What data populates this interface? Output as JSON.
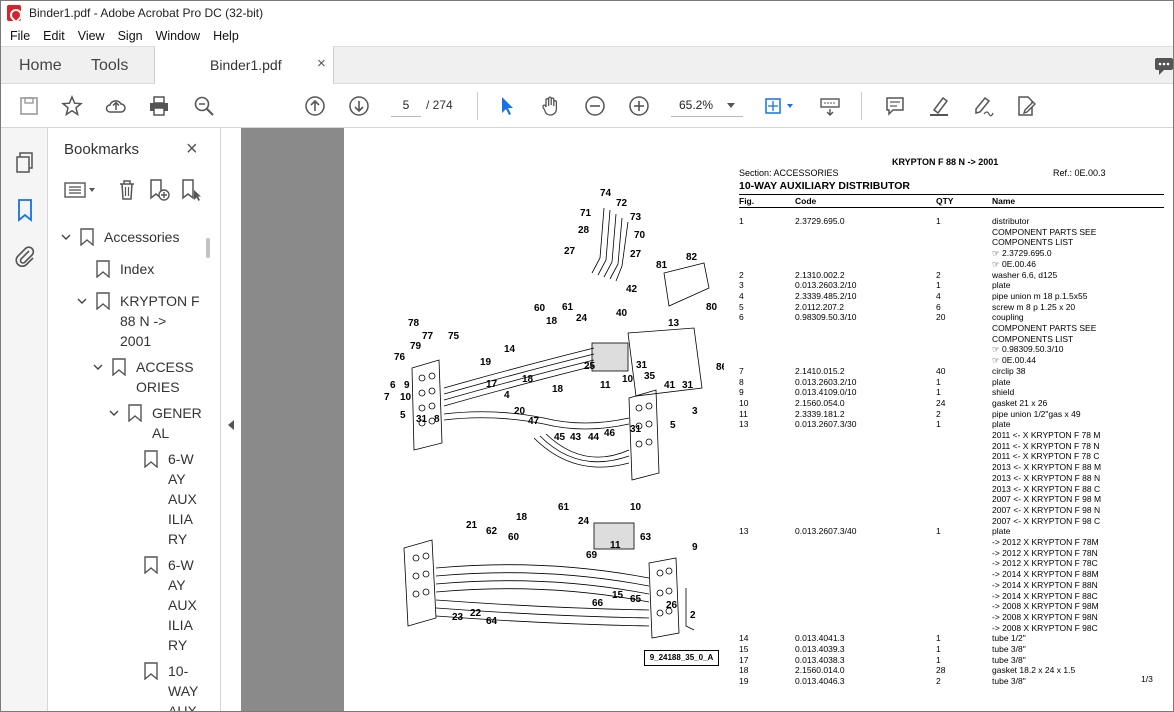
{
  "window": {
    "title": "Binder1.pdf - Adobe Acrobat Pro DC (32-bit)"
  },
  "menu": [
    "File",
    "Edit",
    "View",
    "Sign",
    "Window",
    "Help"
  ],
  "tabs": {
    "home": "Home",
    "tools": "Tools",
    "doc": "Binder1.pdf",
    "close": "×"
  },
  "toolbar": {
    "page_current": "5",
    "page_total": "/  274",
    "zoom": "65.2%"
  },
  "bookmarks": {
    "title": "Bookmarks",
    "close": "×",
    "items": [
      {
        "label": "Accessories"
      },
      {
        "label": "Index"
      },
      {
        "label_lines": [
          "KRYPTON F",
          "88 N ->",
          "2001"
        ]
      },
      {
        "label_lines": [
          "ACCESS",
          "ORIES"
        ]
      },
      {
        "label_lines": [
          "GENER",
          "AL"
        ]
      },
      {
        "label_lines": [
          "6-W",
          "AY",
          "AUX",
          "ILIA",
          "RY"
        ]
      },
      {
        "label_lines": [
          "6-W",
          "AY",
          "AUX",
          "ILIA",
          "RY"
        ]
      },
      {
        "label_lines": [
          "10-",
          "WAY",
          "AUX"
        ]
      }
    ]
  },
  "document": {
    "title": "KRYPTON F 88 N -> 2001",
    "section": "Section: ACCESSORIES",
    "ref": "Ref.: 0E.00.3",
    "heading": "10-WAY AUXILIARY DISTRIBUTOR",
    "columns": [
      "Fig.",
      "Code",
      "QTY",
      "Name"
    ],
    "figure_code": "9_24188_35_0_A",
    "page_number": "1/3",
    "drawing_labels": [
      "74",
      "72",
      "71",
      "73",
      "28",
      "70",
      "27",
      "27",
      "82",
      "81",
      "42",
      "80",
      "60",
      "61",
      "18",
      "24",
      "40",
      "13",
      "78",
      "77",
      "75",
      "79",
      "76",
      "19",
      "14",
      "25",
      "31",
      "86",
      "35",
      "10",
      "18",
      "17",
      "6",
      "9",
      "7",
      "10",
      "5",
      "31",
      "8",
      "4",
      "18",
      "11",
      "41",
      "31",
      "3",
      "20",
      "47",
      "46",
      "45",
      "43",
      "44",
      "31",
      "5",
      "10",
      "61",
      "18",
      "24",
      "21",
      "62",
      "60",
      "11",
      "63",
      "9",
      "69",
      "15",
      "66",
      "65",
      "26",
      "2",
      "23",
      "22",
      "64"
    ],
    "rows": [
      {
        "fig": "1",
        "code": "2.3729.695.0",
        "qty": "1",
        "name": [
          "distributor",
          "COMPONENT PARTS SEE",
          "COMPONENTS LIST",
          "☞ 2.3729.695.0",
          "☞ 0E.00.46"
        ]
      },
      {
        "fig": "2",
        "code": "2.1310.002.2",
        "qty": "2",
        "name": [
          "washer 6.6, d125"
        ]
      },
      {
        "fig": "3",
        "code": "0.013.2603.2/10",
        "qty": "1",
        "name": [
          "plate"
        ]
      },
      {
        "fig": "4",
        "code": "2.3339.485.2/10",
        "qty": "4",
        "name": [
          "pipe union m 18 p.1.5x55"
        ]
      },
      {
        "fig": "5",
        "code": "2.0112.207.2",
        "qty": "6",
        "name": [
          "screw m 8 p 1.25 x 20"
        ]
      },
      {
        "fig": "6",
        "code": "0.98309.50.3/10",
        "qty": "20",
        "name": [
          "coupling",
          "COMPONENT PARTS SEE",
          "COMPONENTS LIST",
          "☞ 0.98309.50.3/10",
          "☞ 0E.00.44"
        ]
      },
      {
        "fig": "7",
        "code": "2.1410.015.2",
        "qty": "40",
        "name": [
          "circlip 38"
        ]
      },
      {
        "fig": "8",
        "code": "0.013.2603.2/10",
        "qty": "1",
        "name": [
          "plate"
        ]
      },
      {
        "fig": "9",
        "code": "0.013.4109.0/10",
        "qty": "1",
        "name": [
          "shield"
        ]
      },
      {
        "fig": "10",
        "code": "2.1560.054.0",
        "qty": "24",
        "name": [
          "gasket 21 x 26"
        ]
      },
      {
        "fig": "11",
        "code": "2.3339.181.2",
        "qty": "2",
        "name": [
          "pipe union 1/2\"gas x 49"
        ]
      },
      {
        "fig": "13",
        "code": "0.013.2607.3/30",
        "qty": "1",
        "name": [
          "plate",
          "2011 <- X KRYPTON F 78 M",
          "2011 <- X KRYPTON F 78 N",
          "2011 <- X KRYPTON F 78 C",
          "2013 <- X KRYPTON F 88 M",
          "2013 <- X KRYPTON F 88 N",
          "2013 <- X KRYPTON F 88 C",
          "2007 <- X KRYPTON F 98 M",
          "2007 <- X KRYPTON F 98 N",
          "2007 <- X KRYPTON F 98 C"
        ]
      },
      {
        "fig": "13",
        "code": "0.013.2607.3/40",
        "qty": "1",
        "name": [
          "plate",
          "-> 2012 X KRYPTON F 78M",
          "-> 2012 X KRYPTON F 78N",
          "-> 2012 X KRYPTON F 78C",
          "-> 2014 X KRYPTON F 88M",
          "-> 2014 X KRYPTON F 88N",
          "-> 2014 X KRYPTON F 88C",
          "-> 2008 X KRYPTON F 98M",
          "-> 2008 X KRYPTON F 98N",
          "-> 2008 X KRYPTON F 98C"
        ]
      },
      {
        "fig": "14",
        "code": "0.013.4041.3",
        "qty": "1",
        "name": [
          "tube 1/2\""
        ]
      },
      {
        "fig": "15",
        "code": "0.013.4039.3",
        "qty": "1",
        "name": [
          "tube 3/8\""
        ]
      },
      {
        "fig": "17",
        "code": "0.013.4038.3",
        "qty": "1",
        "name": [
          "tube 3/8\""
        ]
      },
      {
        "fig": "18",
        "code": "2.1560.014.0",
        "qty": "28",
        "name": [
          "gasket 18.2 x 24 x 1.5"
        ]
      },
      {
        "fig": "19",
        "code": "0.013.4046.3",
        "qty": "2",
        "name": [
          "tube 3/8\""
        ]
      }
    ]
  }
}
